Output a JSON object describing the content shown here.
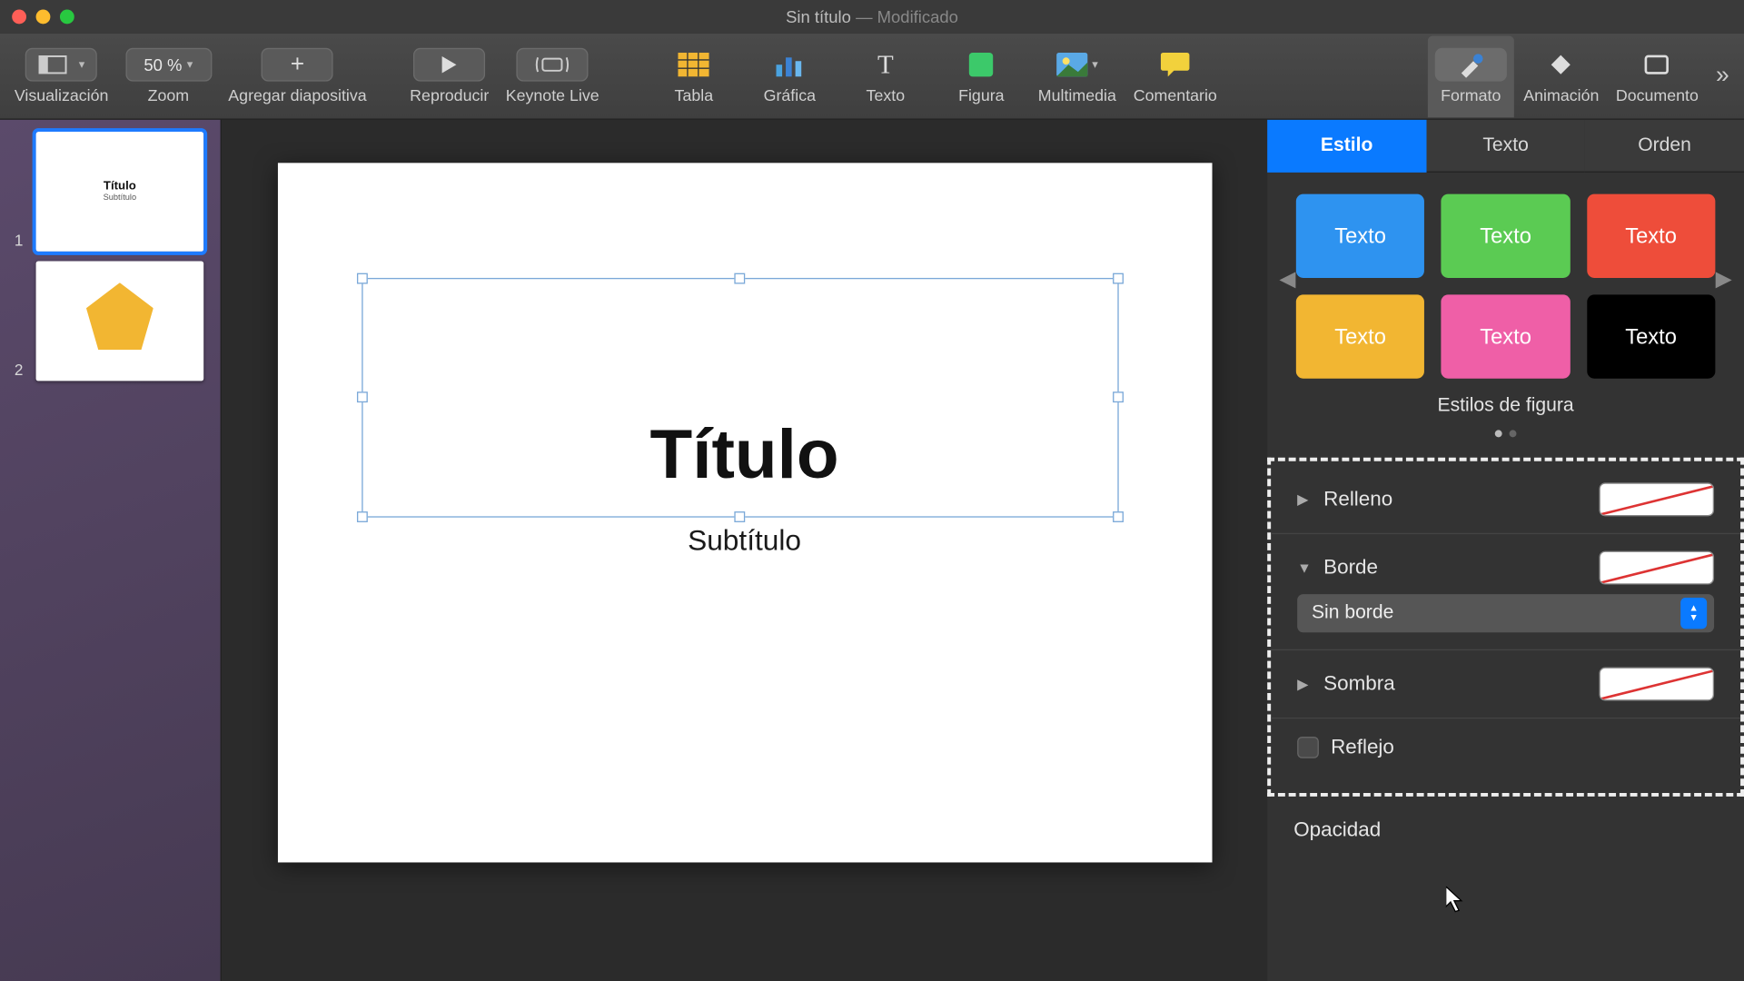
{
  "window": {
    "title": "Sin título",
    "status": "Modificado"
  },
  "toolbar": {
    "visualizacion": "Visualización",
    "zoom_label": "Zoom",
    "zoom_value": "50 %",
    "add_slide": "Agregar diapositiva",
    "play": "Reproducir",
    "live": "Keynote Live",
    "table": "Tabla",
    "chart": "Gráfica",
    "text": "Texto",
    "shape": "Figura",
    "media": "Multimedia",
    "comment": "Comentario",
    "format": "Formato",
    "animate": "Animación",
    "document": "Documento"
  },
  "slides": [
    {
      "num": "1",
      "title": "Título",
      "subtitle": "Subtítulo"
    },
    {
      "num": "2"
    }
  ],
  "canvas": {
    "title": "Título",
    "subtitle": "Subtítulo"
  },
  "inspector": {
    "tabs": {
      "style": "Estilo",
      "text": "Texto",
      "arrange": "Orden"
    },
    "swatch_label": "Texto",
    "swatch_colors": [
      "#2e93f0",
      "#5bcb53",
      "#ee4d3a",
      "#f2b632",
      "#ef5fa7",
      "#000000"
    ],
    "styles_caption": "Estilos de figura",
    "fill": "Relleno",
    "border": "Borde",
    "border_select": "Sin borde",
    "shadow": "Sombra",
    "reflection": "Reflejo",
    "opacity": "Opacidad"
  }
}
